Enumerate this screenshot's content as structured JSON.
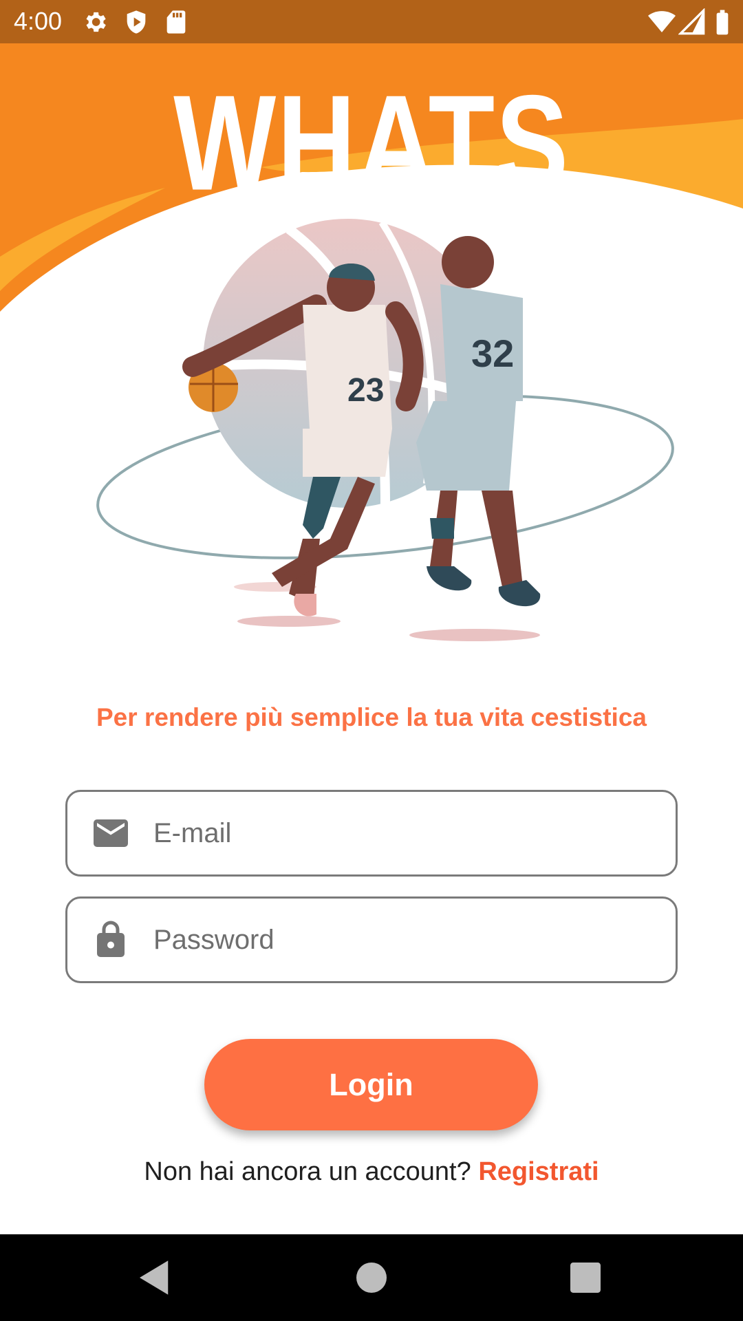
{
  "status_bar": {
    "time": "4:00",
    "icons": [
      "gear-icon",
      "play-protect-icon",
      "sd-card-icon",
      "wifi-icon",
      "signal-icon",
      "battery-icon"
    ]
  },
  "header": {
    "title": "WHATS HOOP",
    "colors": {
      "orange_dark": "#f5871f",
      "orange_light": "#fbab2e"
    }
  },
  "illustration": {
    "jersey_numbers": [
      "23",
      "32"
    ]
  },
  "tagline": "Per rendere più semplice la tua vita cestistica",
  "form": {
    "email_placeholder": "E-mail",
    "password_placeholder": "Password",
    "login_label": "Login"
  },
  "register": {
    "prompt": "Non hai ancora un account?",
    "link": "Registrati"
  },
  "colors": {
    "accent": "#fe7043",
    "link": "#f2572f"
  }
}
